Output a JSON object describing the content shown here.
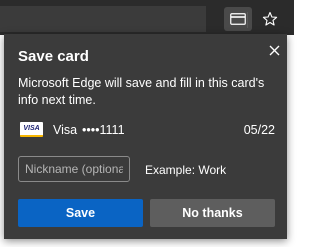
{
  "toolbar": {
    "card_icon": "credit-card-icon",
    "favorite_icon": "star-icon"
  },
  "dialog": {
    "title": "Save card",
    "close_icon": "close-icon",
    "description": "Microsoft Edge will save and fill in this card's info next time.",
    "card": {
      "logo_text": "VISA",
      "brand": "Visa",
      "masked_number": "••••1111",
      "expiry": "05/22"
    },
    "nickname": {
      "value": "",
      "placeholder": "Nickname (optional)",
      "example": "Example: Work"
    },
    "buttons": {
      "save": "Save",
      "no_thanks": "No thanks"
    }
  },
  "colors": {
    "dialog_bg": "#3b3b3b",
    "primary_button": "#0a64c4",
    "secondary_button": "#5e5e5e",
    "text": "#ffffff"
  }
}
